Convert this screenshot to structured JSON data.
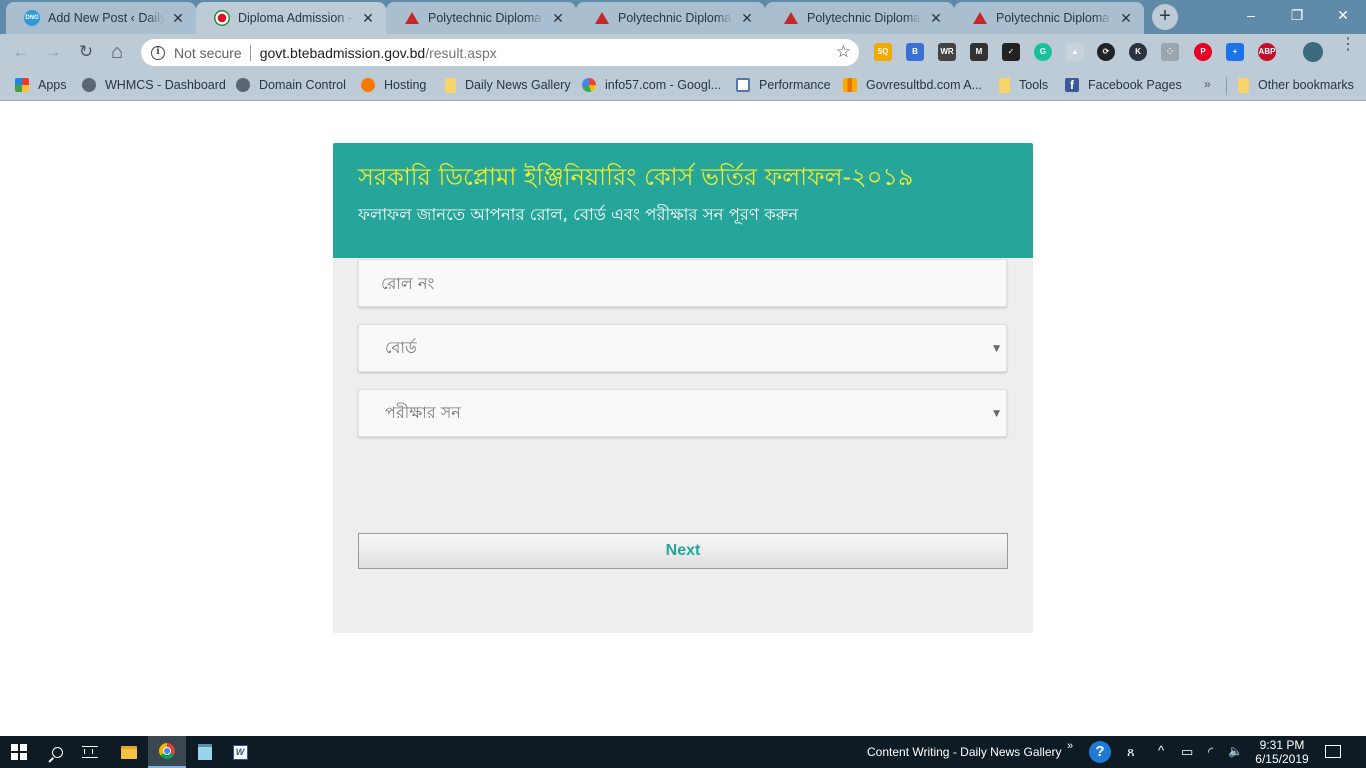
{
  "browser": {
    "tabs": [
      {
        "title": "Add New Post ‹ Daily News Gallery",
        "favicon": "dng-logo-icon",
        "active": false
      },
      {
        "title": "Diploma Admission - Sarkari",
        "favicon": "bangladesh-govt-emblem-icon",
        "active": true
      },
      {
        "title": "Polytechnic Diploma Engineering",
        "favicon": "polytechnic-logo-icon",
        "active": false
      },
      {
        "title": "Polytechnic Diploma Engineering",
        "favicon": "polytechnic-logo-icon",
        "active": false
      },
      {
        "title": "Polytechnic Diploma Admission",
        "favicon": "polytechnic-logo-icon",
        "active": false
      },
      {
        "title": "Polytechnic Diploma Admission",
        "favicon": "polytechnic-logo-icon",
        "active": false
      }
    ],
    "tab_close_glyph": "✕",
    "new_tab_glyph": "+",
    "window_controls": {
      "minimize": "–",
      "restore": "❐",
      "close": "✕"
    },
    "nav": {
      "back": "←",
      "forward": "→",
      "reload": "↻",
      "home": "⌂"
    },
    "omnibox": {
      "security_label": "Not secure",
      "info_glyph": "i",
      "url_host": "govt.btebadmission.gov.bd",
      "url_path": "/result.aspx",
      "star_glyph": "☆"
    },
    "extensions": [
      {
        "name": "5q-extension-icon",
        "label": "5Q",
        "color": "#f2a900"
      },
      {
        "name": "b-extension-icon",
        "label": "B",
        "color": "#3a6fd8"
      },
      {
        "name": "wr-extension-icon",
        "label": "WR",
        "color": "#444444"
      },
      {
        "name": "m-extension-icon",
        "label": "M",
        "color": "#333333"
      },
      {
        "name": "check-extension-icon",
        "label": "✓",
        "color": "#222222"
      },
      {
        "name": "grammarly-icon",
        "label": "G",
        "color": "#15c39a"
      },
      {
        "name": "mountain-extension-icon",
        "label": "▲",
        "color": "#c9d2d9"
      },
      {
        "name": "sync-extension-icon",
        "label": "⟳",
        "color": "#222222"
      },
      {
        "name": "k-extension-icon",
        "label": "K",
        "color": "#2b3340"
      },
      {
        "name": "dots-extension-icon",
        "label": "⁘",
        "color": "#9aa5ad"
      },
      {
        "name": "pinterest-icon",
        "label": "P",
        "color": "#e60023"
      },
      {
        "name": "plus-extension-icon",
        "label": "+",
        "color": "#1a73e8"
      },
      {
        "name": "adblock-plus-icon",
        "label": "ABP",
        "color": "#c70d2c"
      },
      {
        "name": "profile-avatar",
        "label": "",
        "color": "#3b6b7e"
      }
    ],
    "menu_glyph": "⋮",
    "bookmarks": [
      {
        "label": "Apps",
        "icon": "apps-grid-icon"
      },
      {
        "label": "WHMCS - Dashboard",
        "icon": "globe-icon"
      },
      {
        "label": "Domain Control",
        "icon": "globe-icon"
      },
      {
        "label": "Hosting",
        "icon": "hosting-icon"
      },
      {
        "label": "Daily News Gallery",
        "icon": "folder-icon"
      },
      {
        "label": "info57.com - Googl...",
        "icon": "google-icon"
      },
      {
        "label": "Performance",
        "icon": "performance-icon"
      },
      {
        "label": "Govresultbd.com A...",
        "icon": "analytics-icon"
      },
      {
        "label": "Tools",
        "icon": "folder-icon"
      },
      {
        "label": "Facebook Pages",
        "icon": "facebook-icon"
      }
    ],
    "bookmarks_overflow_glyph": "»",
    "other_bookmarks": {
      "label": "Other bookmarks",
      "icon": "folder-icon"
    }
  },
  "page": {
    "header": {
      "title": "সরকারি ডিপ্লোমা ইঞ্জিনিয়ারিং কোর্স ভর্তির ফলাফল-২০১৯",
      "subtitle": "ফলাফল জানতে আপনার রোল, বোর্ড এবং পরীক্ষার সন পূরণ করুন"
    },
    "form": {
      "roll": {
        "placeholder": "রোল নং",
        "value": ""
      },
      "board": {
        "selected": "বোর্ড"
      },
      "year": {
        "selected": "পরীক্ষার সন"
      },
      "select_arrow_glyph": "▼",
      "next_label": "Next"
    },
    "colors": {
      "header_bg": "#26a69a",
      "title": "#f4ee2a",
      "accent": "#26a69a"
    }
  },
  "taskbar": {
    "active_window": "Content Writing - Daily News Gallery",
    "overflow_glyph": "»",
    "help_glyph": "?",
    "people_glyph": "ጸ",
    "tray_up_glyph": "^",
    "battery_glyph": "▭",
    "wifi_glyph": "◜",
    "volume_glyph": "🔈",
    "time": "9:31 PM",
    "date": "6/15/2019"
  }
}
